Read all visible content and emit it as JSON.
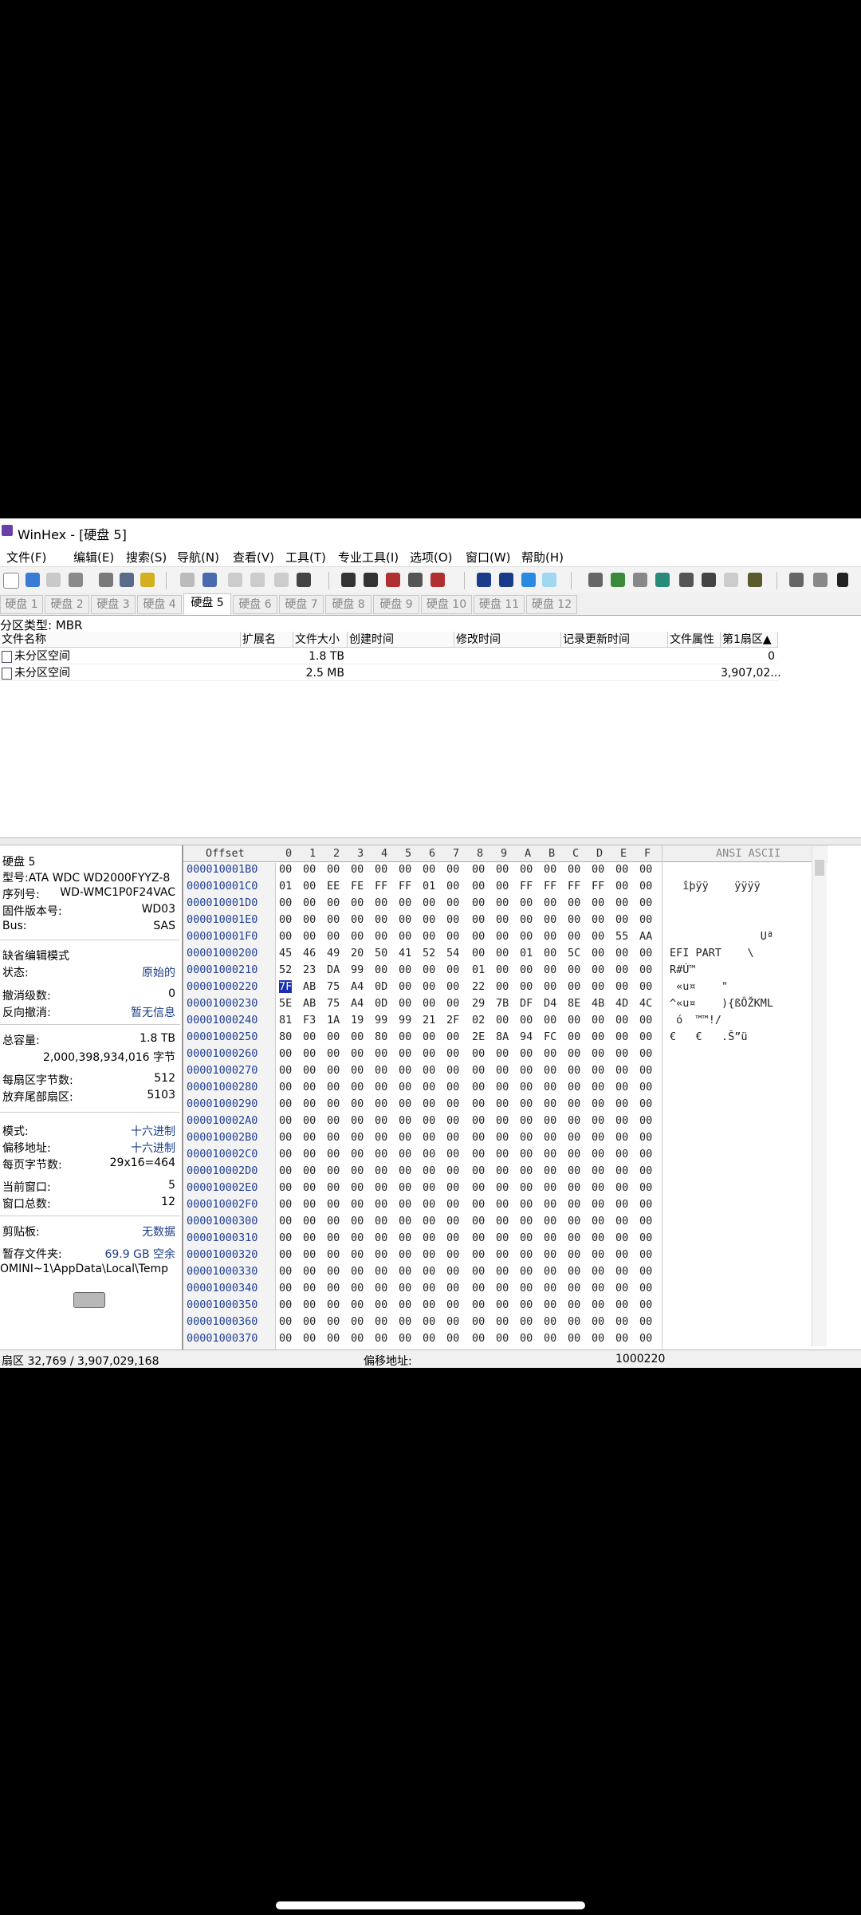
{
  "window": {
    "title": "WinHex - [硬盘 5]"
  },
  "menu": [
    "文件(F)",
    "编辑(E)",
    "搜索(S)",
    "导航(N)",
    "查看(V)",
    "工具(T)",
    "专业工具(I)",
    "选项(O)",
    "窗口(W)",
    "帮助(H)"
  ],
  "tabs": [
    "硬盘 1",
    "硬盘 2",
    "硬盘 3",
    "硬盘 4",
    "硬盘 5",
    "硬盘 6",
    "硬盘 7",
    "硬盘 8",
    "硬盘 9",
    "硬盘 10",
    "硬盘 11",
    "硬盘 12"
  ],
  "active_tab": "硬盘 5",
  "partition_type": "分区类型: MBR",
  "file_list": {
    "headers": [
      "文件名称",
      "扩展名",
      "文件大小",
      "创建时间",
      "修改时间",
      "记录更新时间",
      "文件属性",
      "第1扇区▲"
    ],
    "rows": [
      {
        "name": "未分区空间",
        "size": "1.8 TB",
        "first_sector": "0"
      },
      {
        "name": "未分区空间",
        "size": "2.5 MB",
        "first_sector": "3,907,02..."
      }
    ]
  },
  "info": {
    "disk_name": "硬盘 5",
    "model": "型号:ATA WDC WD2000FYYZ-8",
    "serial_label": "序列号:",
    "serial_value": "WD-WMC1P0F24VAC",
    "firmware_label": "固件版本号:",
    "firmware_value": "WD03",
    "bus_label": "Bus:",
    "bus_value": "SAS",
    "edit_mode": "缺省编辑模式",
    "state_label": "状态:",
    "state_value": "原始的",
    "undo_label": "撤消级数:",
    "undo_value": "0",
    "reverse_label": "反向撤消:",
    "reverse_value": "暂无信息",
    "capacity_label": "总容量:",
    "capacity_value": "1.8 TB",
    "capacity_bytes": "2,000,398,934,016 字节",
    "bps_label": "每扇区字节数:",
    "bps_value": "512",
    "tail_label": "放弃尾部扇区:",
    "tail_value": "5103",
    "mode_label": "模式:",
    "mode_value": "十六进制",
    "offset_label": "偏移地址:",
    "offset_value": "十六进制",
    "perpage_label": "每页字节数:",
    "perpage_value": "29x16=464",
    "curwin_label": "当前窗口:",
    "curwin_value": "5",
    "wincount_label": "窗口总数:",
    "wincount_value": "12",
    "clipboard_label": "剪贴板:",
    "clipboard_value": "无数据",
    "tempdir_label": "暂存文件夹:",
    "tempdir_value": "69.9 GB 空余",
    "temp_path": "OMINI~1\\AppData\\Local\\Temp"
  },
  "hex": {
    "offset_header": "Offset",
    "col_headers": [
      "0",
      "1",
      "2",
      "3",
      "4",
      "5",
      "6",
      "7",
      "8",
      "9",
      "A",
      "B",
      "C",
      "D",
      "E",
      "F"
    ],
    "ascii_header": "ANSI ASCII",
    "rows": [
      {
        "off": "000010001B0",
        "bytes": [
          "00",
          "00",
          "00",
          "00",
          "00",
          "00",
          "00",
          "00",
          "00",
          "00",
          "00",
          "00",
          "00",
          "00",
          "00",
          "00"
        ],
        "ascii": ""
      },
      {
        "off": "000010001C0",
        "bytes": [
          "01",
          "00",
          "EE",
          "FE",
          "FF",
          "FF",
          "01",
          "00",
          "00",
          "00",
          "FF",
          "FF",
          "FF",
          "FF",
          "00",
          "00"
        ],
        "ascii": "  îþÿÿ    ÿÿÿÿ"
      },
      {
        "off": "000010001D0",
        "bytes": [
          "00",
          "00",
          "00",
          "00",
          "00",
          "00",
          "00",
          "00",
          "00",
          "00",
          "00",
          "00",
          "00",
          "00",
          "00",
          "00"
        ],
        "ascii": ""
      },
      {
        "off": "000010001E0",
        "bytes": [
          "00",
          "00",
          "00",
          "00",
          "00",
          "00",
          "00",
          "00",
          "00",
          "00",
          "00",
          "00",
          "00",
          "00",
          "00",
          "00"
        ],
        "ascii": ""
      },
      {
        "off": "000010001F0",
        "bytes": [
          "00",
          "00",
          "00",
          "00",
          "00",
          "00",
          "00",
          "00",
          "00",
          "00",
          "00",
          "00",
          "00",
          "00",
          "55",
          "AA"
        ],
        "ascii": "              Uª"
      },
      {
        "off": "00001000200",
        "bytes": [
          "45",
          "46",
          "49",
          "20",
          "50",
          "41",
          "52",
          "54",
          "00",
          "00",
          "01",
          "00",
          "5C",
          "00",
          "00",
          "00"
        ],
        "ascii": "EFI PART    \\"
      },
      {
        "off": "00001000210",
        "bytes": [
          "52",
          "23",
          "DA",
          "99",
          "00",
          "00",
          "00",
          "00",
          "01",
          "00",
          "00",
          "00",
          "00",
          "00",
          "00",
          "00"
        ],
        "ascii": "R#Ú™"
      },
      {
        "off": "00001000220",
        "bytes": [
          "7F",
          "AB",
          "75",
          "A4",
          "0D",
          "00",
          "00",
          "00",
          "22",
          "00",
          "00",
          "00",
          "00",
          "00",
          "00",
          "00"
        ],
        "ascii": " «u¤    \""
      },
      {
        "off": "00001000230",
        "bytes": [
          "5E",
          "AB",
          "75",
          "A4",
          "0D",
          "00",
          "00",
          "00",
          "29",
          "7B",
          "DF",
          "D4",
          "8E",
          "4B",
          "4D",
          "4C"
        ],
        "ascii": "^«u¤    ){ßÔŽKML"
      },
      {
        "off": "00001000240",
        "bytes": [
          "81",
          "F3",
          "1A",
          "19",
          "99",
          "99",
          "21",
          "2F",
          "02",
          "00",
          "00",
          "00",
          "00",
          "00",
          "00",
          "00"
        ],
        "ascii": " ó  ™™!/"
      },
      {
        "off": "00001000250",
        "bytes": [
          "80",
          "00",
          "00",
          "00",
          "80",
          "00",
          "00",
          "00",
          "2E",
          "8A",
          "94",
          "FC",
          "00",
          "00",
          "00",
          "00"
        ],
        "ascii": "€   €   .Š”ü"
      },
      {
        "off": "00001000260",
        "bytes": [
          "00",
          "00",
          "00",
          "00",
          "00",
          "00",
          "00",
          "00",
          "00",
          "00",
          "00",
          "00",
          "00",
          "00",
          "00",
          "00"
        ],
        "ascii": ""
      },
      {
        "off": "00001000270",
        "bytes": [
          "00",
          "00",
          "00",
          "00",
          "00",
          "00",
          "00",
          "00",
          "00",
          "00",
          "00",
          "00",
          "00",
          "00",
          "00",
          "00"
        ],
        "ascii": ""
      },
      {
        "off": "00001000280",
        "bytes": [
          "00",
          "00",
          "00",
          "00",
          "00",
          "00",
          "00",
          "00",
          "00",
          "00",
          "00",
          "00",
          "00",
          "00",
          "00",
          "00"
        ],
        "ascii": ""
      },
      {
        "off": "00001000290",
        "bytes": [
          "00",
          "00",
          "00",
          "00",
          "00",
          "00",
          "00",
          "00",
          "00",
          "00",
          "00",
          "00",
          "00",
          "00",
          "00",
          "00"
        ],
        "ascii": ""
      },
      {
        "off": "000010002A0",
        "bytes": [
          "00",
          "00",
          "00",
          "00",
          "00",
          "00",
          "00",
          "00",
          "00",
          "00",
          "00",
          "00",
          "00",
          "00",
          "00",
          "00"
        ],
        "ascii": ""
      },
      {
        "off": "000010002B0",
        "bytes": [
          "00",
          "00",
          "00",
          "00",
          "00",
          "00",
          "00",
          "00",
          "00",
          "00",
          "00",
          "00",
          "00",
          "00",
          "00",
          "00"
        ],
        "ascii": ""
      },
      {
        "off": "000010002C0",
        "bytes": [
          "00",
          "00",
          "00",
          "00",
          "00",
          "00",
          "00",
          "00",
          "00",
          "00",
          "00",
          "00",
          "00",
          "00",
          "00",
          "00"
        ],
        "ascii": ""
      },
      {
        "off": "000010002D0",
        "bytes": [
          "00",
          "00",
          "00",
          "00",
          "00",
          "00",
          "00",
          "00",
          "00",
          "00",
          "00",
          "00",
          "00",
          "00",
          "00",
          "00"
        ],
        "ascii": ""
      },
      {
        "off": "000010002E0",
        "bytes": [
          "00",
          "00",
          "00",
          "00",
          "00",
          "00",
          "00",
          "00",
          "00",
          "00",
          "00",
          "00",
          "00",
          "00",
          "00",
          "00"
        ],
        "ascii": ""
      },
      {
        "off": "000010002F0",
        "bytes": [
          "00",
          "00",
          "00",
          "00",
          "00",
          "00",
          "00",
          "00",
          "00",
          "00",
          "00",
          "00",
          "00",
          "00",
          "00",
          "00"
        ],
        "ascii": ""
      },
      {
        "off": "00001000300",
        "bytes": [
          "00",
          "00",
          "00",
          "00",
          "00",
          "00",
          "00",
          "00",
          "00",
          "00",
          "00",
          "00",
          "00",
          "00",
          "00",
          "00"
        ],
        "ascii": ""
      },
      {
        "off": "00001000310",
        "bytes": [
          "00",
          "00",
          "00",
          "00",
          "00",
          "00",
          "00",
          "00",
          "00",
          "00",
          "00",
          "00",
          "00",
          "00",
          "00",
          "00"
        ],
        "ascii": ""
      },
      {
        "off": "00001000320",
        "bytes": [
          "00",
          "00",
          "00",
          "00",
          "00",
          "00",
          "00",
          "00",
          "00",
          "00",
          "00",
          "00",
          "00",
          "00",
          "00",
          "00"
        ],
        "ascii": ""
      },
      {
        "off": "00001000330",
        "bytes": [
          "00",
          "00",
          "00",
          "00",
          "00",
          "00",
          "00",
          "00",
          "00",
          "00",
          "00",
          "00",
          "00",
          "00",
          "00",
          "00"
        ],
        "ascii": ""
      },
      {
        "off": "00001000340",
        "bytes": [
          "00",
          "00",
          "00",
          "00",
          "00",
          "00",
          "00",
          "00",
          "00",
          "00",
          "00",
          "00",
          "00",
          "00",
          "00",
          "00"
        ],
        "ascii": ""
      },
      {
        "off": "00001000350",
        "bytes": [
          "00",
          "00",
          "00",
          "00",
          "00",
          "00",
          "00",
          "00",
          "00",
          "00",
          "00",
          "00",
          "00",
          "00",
          "00",
          "00"
        ],
        "ascii": ""
      },
      {
        "off": "00001000360",
        "bytes": [
          "00",
          "00",
          "00",
          "00",
          "00",
          "00",
          "00",
          "00",
          "00",
          "00",
          "00",
          "00",
          "00",
          "00",
          "00",
          "00"
        ],
        "ascii": ""
      },
      {
        "off": "00001000370",
        "bytes": [
          "00",
          "00",
          "00",
          "00",
          "00",
          "00",
          "00",
          "00",
          "00",
          "00",
          "00",
          "00",
          "00",
          "00",
          "00",
          "00"
        ],
        "ascii": ""
      }
    ]
  },
  "status": {
    "sector": "扇区 32,769 / 3,907,029,168",
    "offset_label": "偏移地址:",
    "offset_value": "1000220"
  },
  "colors": {
    "accent": "#1a30b0",
    "offset_text": "#1f3f96",
    "info_value": "#1a3c8a"
  }
}
